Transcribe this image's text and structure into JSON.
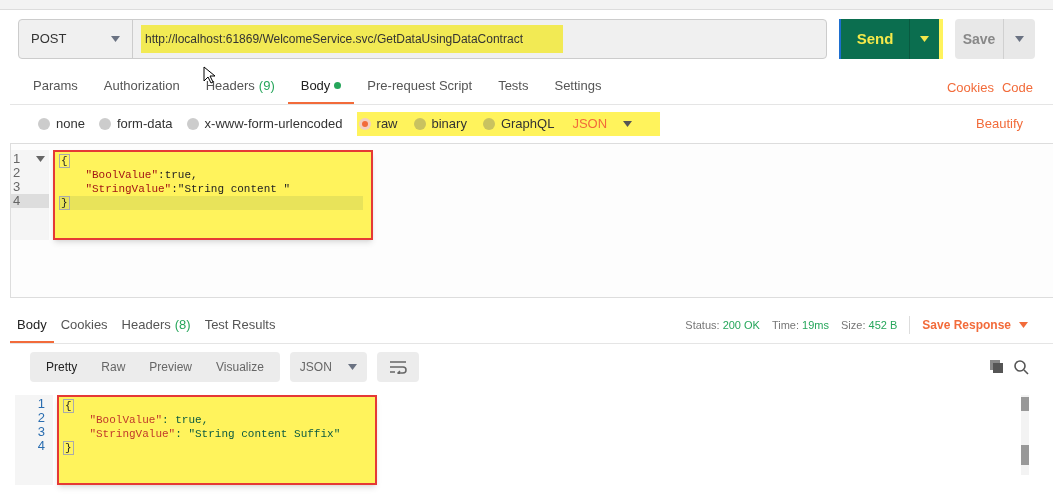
{
  "request": {
    "method": "POST",
    "url": "http://localhost:61869/WelcomeService.svc/GetDataUsingDataContract",
    "url_highlighted": true,
    "send": "Send",
    "save": "Save"
  },
  "request_tabs": [
    {
      "label": "Params",
      "selected": false
    },
    {
      "label": "Authorization",
      "selected": false
    },
    {
      "label": "Headers",
      "count": "(9)",
      "selected": false
    },
    {
      "label": "Body",
      "dot": true,
      "selected": true
    },
    {
      "label": "Pre-request Script",
      "selected": false
    },
    {
      "label": "Tests",
      "selected": false
    },
    {
      "label": "Settings",
      "selected": false
    }
  ],
  "request_links": [
    "Cookies",
    "Code"
  ],
  "body_types": [
    {
      "label": "none",
      "selected": false,
      "highlighted": false
    },
    {
      "label": "form-data",
      "selected": false,
      "highlighted": false
    },
    {
      "label": "x-www-form-urlencoded",
      "selected": false,
      "highlighted": false
    },
    {
      "label": "raw",
      "selected": true,
      "highlighted": true
    },
    {
      "label": "binary",
      "selected": false,
      "highlighted": true
    },
    {
      "label": "GraphQL",
      "selected": false,
      "highlighted": true
    }
  ],
  "body_format": {
    "label": "JSON",
    "highlighted": true
  },
  "beautify": "Beautify",
  "request_body": {
    "highlighted": true,
    "lines": [
      {
        "number": "1",
        "fold": true,
        "tokens": [
          {
            "kind": "punct",
            "text": "{"
          }
        ]
      },
      {
        "number": "2",
        "tokens": [
          {
            "kind": "key",
            "text": "    \"BoolValue\""
          },
          {
            "kind": "plain",
            "text": ":true,"
          }
        ]
      },
      {
        "number": "3",
        "tokens": [
          {
            "kind": "key",
            "text": "    \"StringValue\""
          },
          {
            "kind": "plain",
            "text": ":\"String content \""
          }
        ]
      },
      {
        "number": "4",
        "active": true,
        "tokens": [
          {
            "kind": "punct",
            "text": "}"
          }
        ]
      }
    ]
  },
  "response_tabs": [
    {
      "label": "Body",
      "selected": true
    },
    {
      "label": "Cookies",
      "selected": false
    },
    {
      "label": "Headers",
      "count": "(8)",
      "selected": false
    },
    {
      "label": "Test Results",
      "selected": false
    }
  ],
  "response_meta": [
    {
      "label": "Status:",
      "value": "200 OK"
    },
    {
      "label": "Time:",
      "value": "19ms"
    },
    {
      "label": "Size:",
      "value": "452 B"
    }
  ],
  "save_response": "Save Response",
  "view_modes": [
    {
      "label": "Pretty",
      "selected": true
    },
    {
      "label": "Raw",
      "selected": false
    },
    {
      "label": "Preview",
      "selected": false
    },
    {
      "label": "Visualize",
      "selected": false
    }
  ],
  "response_format": "JSON",
  "response_body": {
    "highlighted": true,
    "lines": [
      {
        "number": "1",
        "tokens": [
          {
            "kind": "punct",
            "text": "{"
          }
        ]
      },
      {
        "number": "2",
        "tokens": [
          {
            "kind": "key",
            "text": "    \"BoolValue\""
          },
          {
            "kind": "plain",
            "text": ": true,"
          }
        ]
      },
      {
        "number": "3",
        "tokens": [
          {
            "kind": "key",
            "text": "    \"StringValue\""
          },
          {
            "kind": "plain",
            "text": ": "
          },
          {
            "kind": "string",
            "text": "\"String content Suffix\""
          }
        ]
      },
      {
        "number": "4",
        "tokens": [
          {
            "kind": "punct",
            "text": "}"
          }
        ]
      }
    ]
  }
}
